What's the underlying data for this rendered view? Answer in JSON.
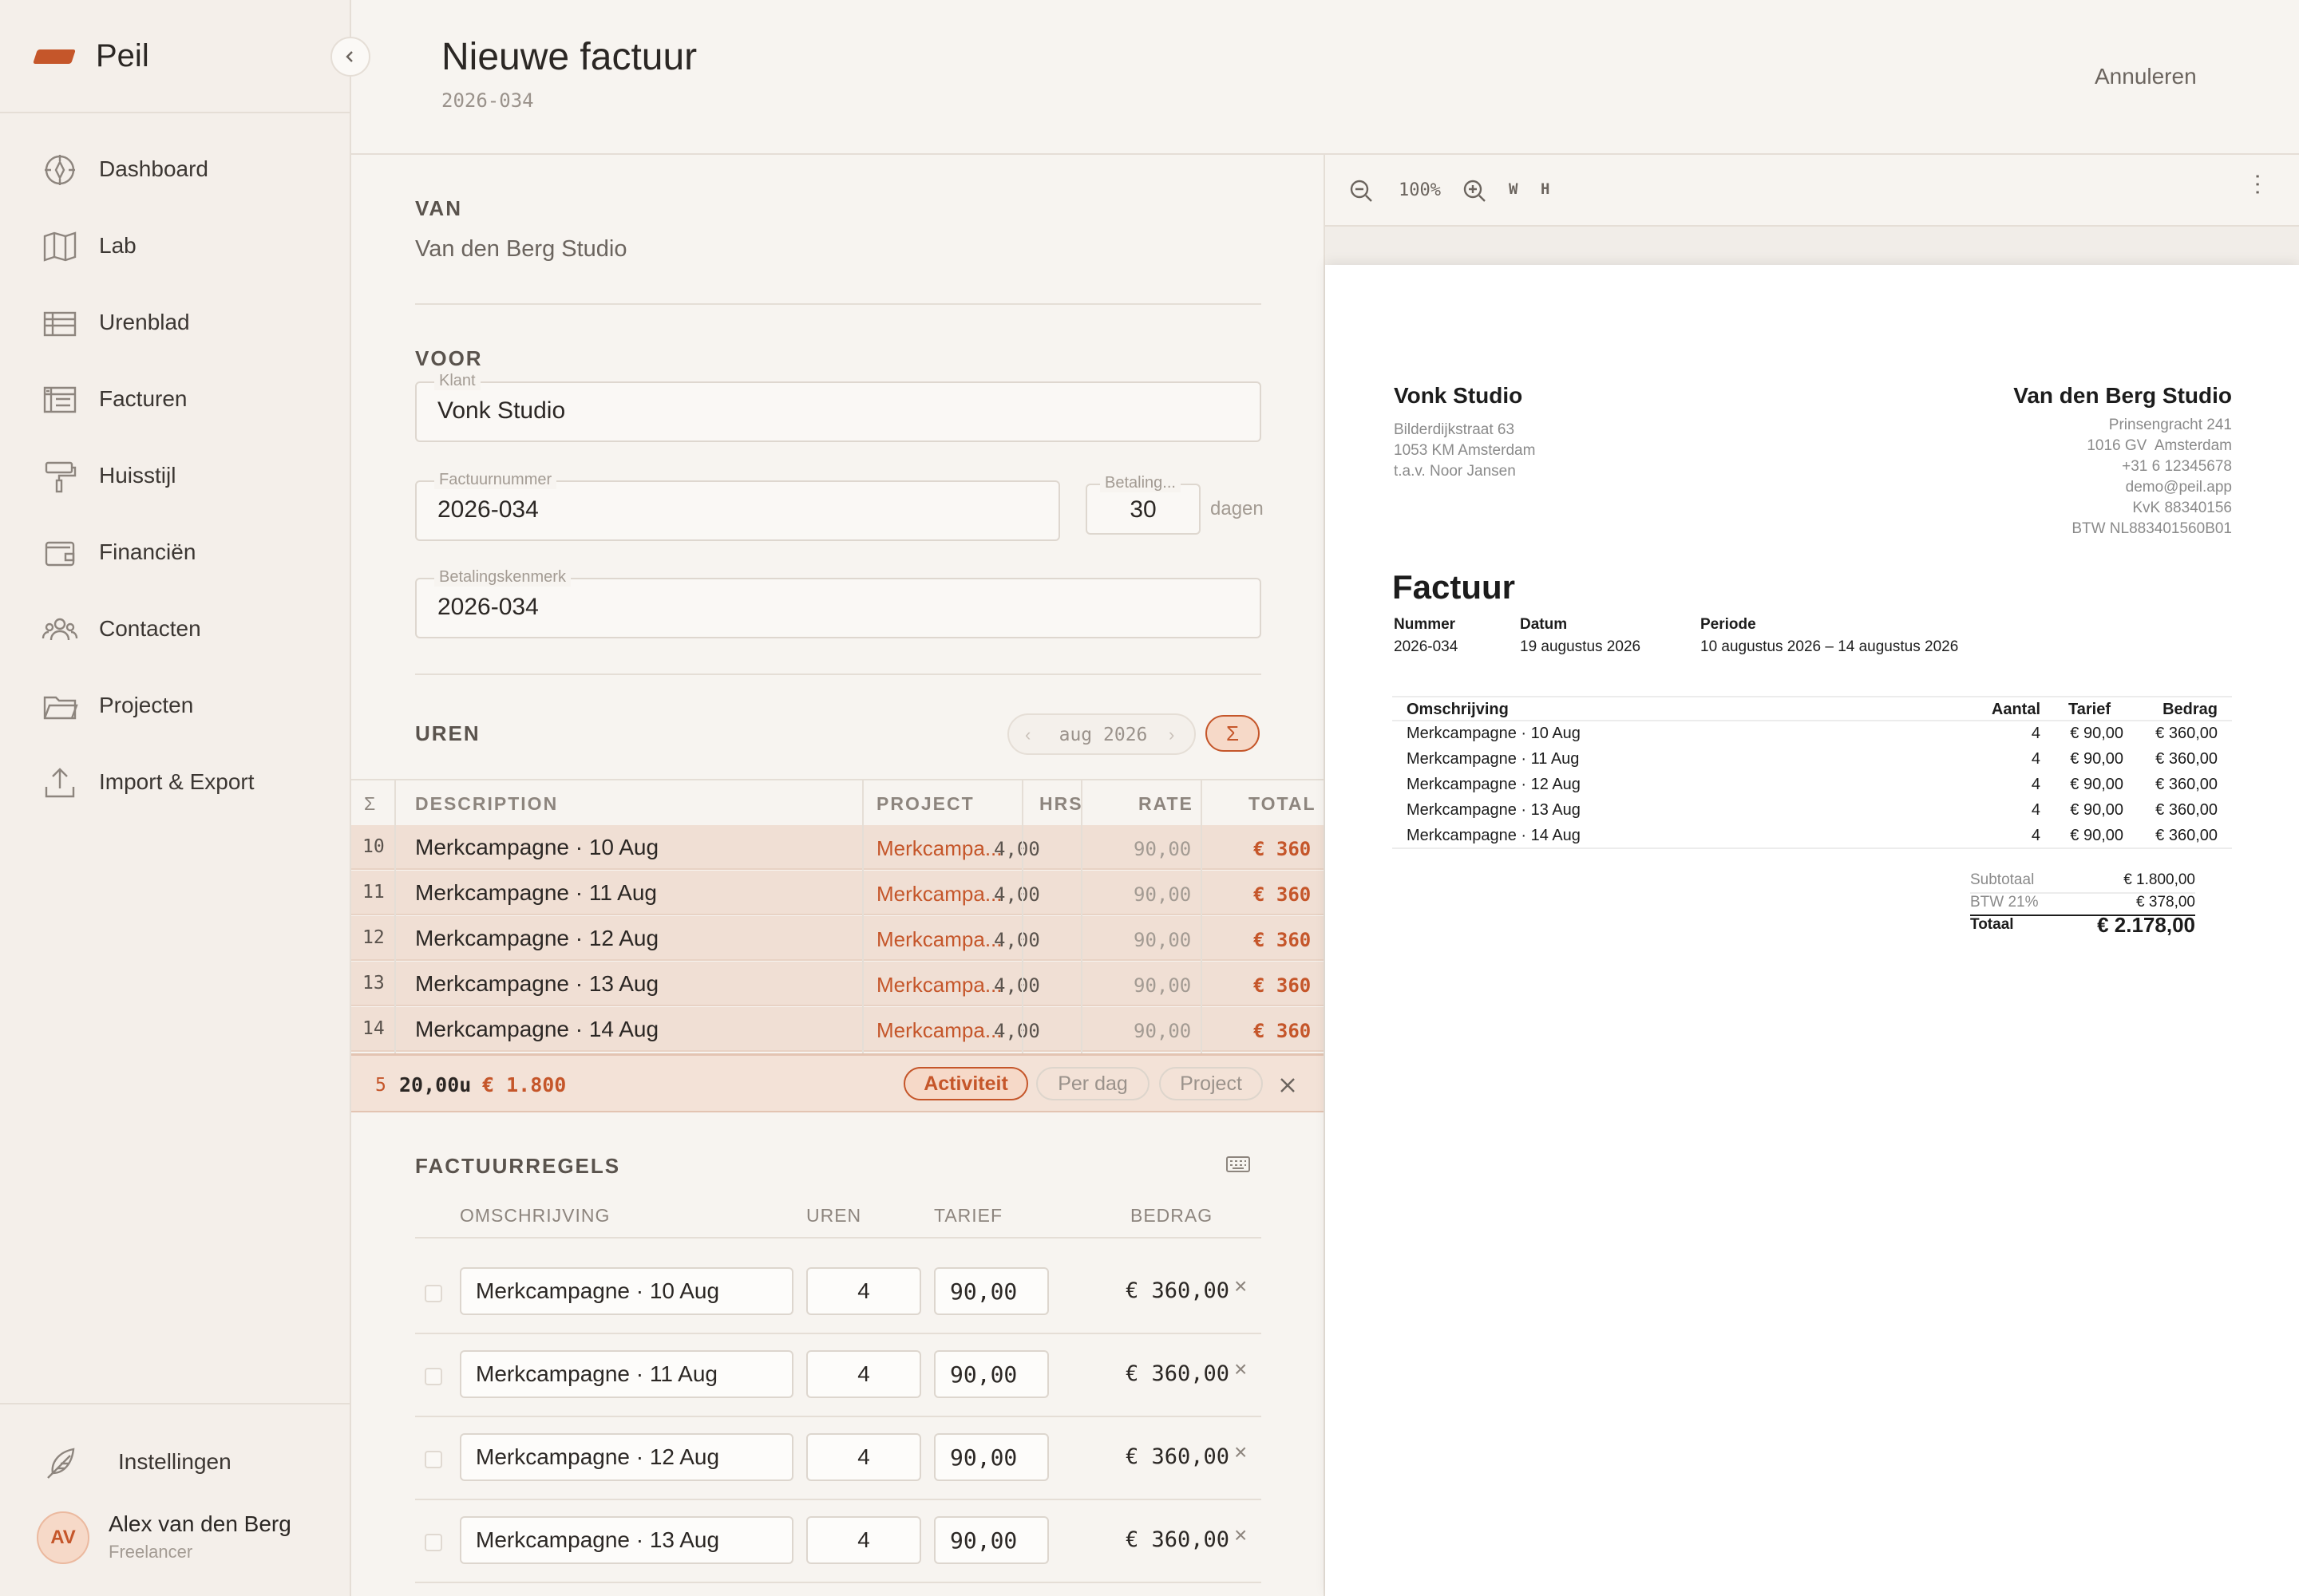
{
  "app": {
    "name": "Peil",
    "collapse_icon": "chevron-left-icon"
  },
  "sidebar": {
    "items": [
      {
        "label": "Dashboard",
        "icon": "compass-icon"
      },
      {
        "label": "Lab",
        "icon": "map-icon"
      },
      {
        "label": "Urenblad",
        "icon": "table-icon"
      },
      {
        "label": "Facturen",
        "icon": "invoice-icon"
      },
      {
        "label": "Huisstijl",
        "icon": "paint-roller-icon"
      },
      {
        "label": "Financiën",
        "icon": "wallet-icon"
      },
      {
        "label": "Contacten",
        "icon": "users-icon"
      },
      {
        "label": "Projecten",
        "icon": "folder-icon"
      },
      {
        "label": "Import & Export",
        "icon": "upload-icon"
      }
    ],
    "settings_label": "Instellingen",
    "user": {
      "initials": "AV",
      "name": "Alex van den Berg",
      "role": "Freelancer"
    }
  },
  "header": {
    "title": "Nieuwe factuur",
    "subtitle": "2026-034",
    "cancel_label": "Annuleren"
  },
  "form": {
    "van_label": "VAN",
    "van_value": "Van den Berg Studio",
    "voor_label": "VOOR",
    "klant_label": "Klant",
    "klant_value": "Vonk Studio",
    "factuurnummer_label": "Factuurnummer",
    "factuurnummer_value": "2026-034",
    "betaling_label": "Betaling...",
    "betaling_value": "30",
    "betaling_unit": "dagen",
    "kenmerk_label": "Betalingskenmerk",
    "kenmerk_value": "2026-034"
  },
  "uren": {
    "label": "UREN",
    "month": "aug 2026",
    "sigma": "Σ",
    "columns": {
      "sigma": "Σ",
      "description": "DESCRIPTION",
      "project": "PROJECT",
      "hrs": "HRS",
      "rate": "RATE",
      "total": "TOTAL"
    },
    "rows": [
      {
        "day": "10",
        "description": "Merkcampagne · 10 Aug",
        "project": "Merkcampa...",
        "hrs": "4,00",
        "rate": "90,00",
        "total": "€ 360"
      },
      {
        "day": "11",
        "description": "Merkcampagne · 11 Aug",
        "project": "Merkcampa...",
        "hrs": "4,00",
        "rate": "90,00",
        "total": "€ 360"
      },
      {
        "day": "12",
        "description": "Merkcampagne · 12 Aug",
        "project": "Merkcampa...",
        "hrs": "4,00",
        "rate": "90,00",
        "total": "€ 360"
      },
      {
        "day": "13",
        "description": "Merkcampagne · 13 Aug",
        "project": "Merkcampa...",
        "hrs": "4,00",
        "rate": "90,00",
        "total": "€ 360"
      },
      {
        "day": "14",
        "description": "Merkcampagne · 14 Aug",
        "project": "Merkcampa...",
        "hrs": "4,00",
        "rate": "90,00",
        "total": "€ 360"
      }
    ],
    "summary": {
      "count": "5",
      "hours": "20,00u",
      "total": "€ 1.800"
    },
    "group_options": [
      "Activiteit",
      "Per dag",
      "Project"
    ],
    "group_selected": "Activiteit",
    "close_icon": "close-icon"
  },
  "factuurregels": {
    "label": "FACTUURREGELS",
    "columns": {
      "omschrijving": "OMSCHRIJVING",
      "uren": "UREN",
      "tarief": "TARIEF",
      "bedrag": "BEDRAG"
    },
    "rows": [
      {
        "omschrijving": "Merkcampagne · 10 Aug",
        "uren": "4",
        "tarief": "90,00",
        "bedrag": "€ 360,00"
      },
      {
        "omschrijving": "Merkcampagne · 11 Aug",
        "uren": "4",
        "tarief": "90,00",
        "bedrag": "€ 360,00"
      },
      {
        "omschrijving": "Merkcampagne · 12 Aug",
        "uren": "4",
        "tarief": "90,00",
        "bedrag": "€ 360,00"
      },
      {
        "omschrijving": "Merkcampagne · 13 Aug",
        "uren": "4",
        "tarief": "90,00",
        "bedrag": "€ 360,00"
      }
    ]
  },
  "preview": {
    "zoom": "100%",
    "fit_width": "W",
    "fit_height": "H",
    "client": {
      "name": "Vonk Studio",
      "lines": [
        "Bilderdijkstraat 63",
        "1053 KM Amsterdam",
        "t.a.v. Noor Jansen"
      ]
    },
    "sender": {
      "name": "Van den Berg Studio",
      "lines": [
        "Prinsengracht 241",
        "1016 GV  Amsterdam",
        "+31 6 12345678",
        "demo@peil.app",
        "KvK 88340156",
        "BTW NL883401560B01"
      ]
    },
    "doc_title": "Factuur",
    "meta": {
      "nummer_label": "Nummer",
      "nummer": "2026-034",
      "datum_label": "Datum",
      "datum": "19 augustus 2026",
      "periode_label": "Periode",
      "periode": "10 augustus 2026 – 14 augustus 2026"
    },
    "table_head": {
      "omschrijving": "Omschrijving",
      "aantal": "Aantal",
      "tarief": "Tarief",
      "bedrag": "Bedrag"
    },
    "lines": [
      {
        "omschrijving": "Merkcampagne · 10 Aug",
        "aantal": "4",
        "tarief": "€ 90,00",
        "bedrag": "€ 360,00"
      },
      {
        "omschrijving": "Merkcampagne · 11 Aug",
        "aantal": "4",
        "tarief": "€ 90,00",
        "bedrag": "€ 360,00"
      },
      {
        "omschrijving": "Merkcampagne · 12 Aug",
        "aantal": "4",
        "tarief": "€ 90,00",
        "bedrag": "€ 360,00"
      },
      {
        "omschrijving": "Merkcampagne · 13 Aug",
        "aantal": "4",
        "tarief": "€ 90,00",
        "bedrag": "€ 360,00"
      },
      {
        "omschrijving": "Merkcampagne · 14 Aug",
        "aantal": "4",
        "tarief": "€ 90,00",
        "bedrag": "€ 360,00"
      }
    ],
    "totals": {
      "subtotaal_label": "Subtotaal",
      "subtotaal": "€ 1.800,00",
      "btw_label": "BTW 21%",
      "btw": "€ 378,00",
      "totaal_label": "Totaal",
      "totaal": "€ 2.178,00"
    }
  },
  "colors": {
    "accent": "#c5562a",
    "sidebar_bg": "#f4efea",
    "page_bg": "#f7f4f0",
    "row_highlight": "#f0dfd4"
  }
}
